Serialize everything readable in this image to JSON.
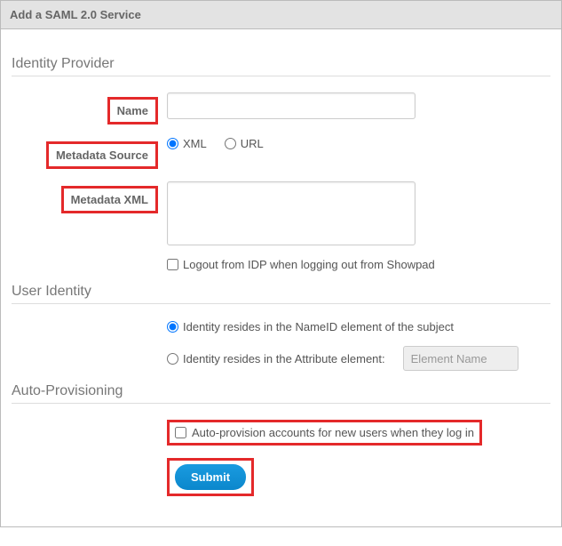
{
  "header": {
    "title": "Add a SAML 2.0 Service"
  },
  "identity_provider": {
    "section_title": "Identity Provider",
    "name_label": "Name",
    "name_value": "",
    "metadata_source_label": "Metadata Source",
    "metadata_source_options": {
      "xml": "XML",
      "url": "URL"
    },
    "metadata_source_selected": "xml",
    "metadata_xml_label": "Metadata XML",
    "metadata_xml_value": "",
    "logout_checkbox_label": "Logout from IDP when logging out from Showpad",
    "logout_checked": false
  },
  "user_identity": {
    "section_title": "User Identity",
    "option_nameid": "Identity resides in the NameID element of the subject",
    "option_attribute": "Identity resides in the Attribute element:",
    "attribute_placeholder": "Element Name",
    "selected": "nameid"
  },
  "auto_provisioning": {
    "section_title": "Auto-Provisioning",
    "checkbox_label": "Auto-provision accounts for new users when they log in",
    "checked": false,
    "submit_label": "Submit"
  }
}
